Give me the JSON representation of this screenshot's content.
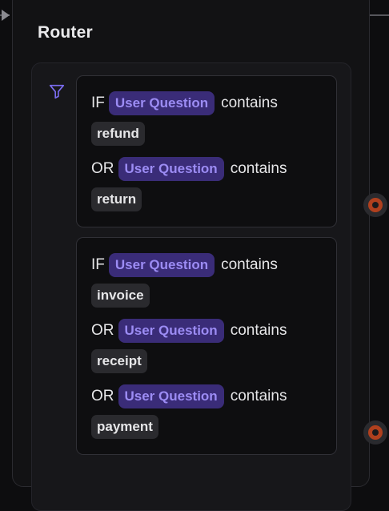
{
  "node": {
    "title": "Router"
  },
  "rules": [
    {
      "conditions": [
        {
          "op": "IF",
          "variable": "User Question",
          "verb": "contains",
          "value": "refund"
        },
        {
          "op": "OR",
          "variable": "User Question",
          "verb": "contains",
          "value": "return"
        }
      ]
    },
    {
      "conditions": [
        {
          "op": "IF",
          "variable": "User Question",
          "verb": "contains",
          "value": "invoice"
        },
        {
          "op": "OR",
          "variable": "User Question",
          "verb": "contains",
          "value": "receipt"
        },
        {
          "op": "OR",
          "variable": "User Question",
          "verb": "contains",
          "value": "payment"
        }
      ]
    }
  ],
  "icons": {
    "filter": "filter-icon",
    "output_port": "output-port-handle",
    "input": "input-arrow"
  },
  "colors": {
    "variable_chip_bg": "#3a2c78",
    "variable_chip_text": "#9c8cf4",
    "port_accent": "#b0401e",
    "filter_icon": "#7b6cf0"
  }
}
